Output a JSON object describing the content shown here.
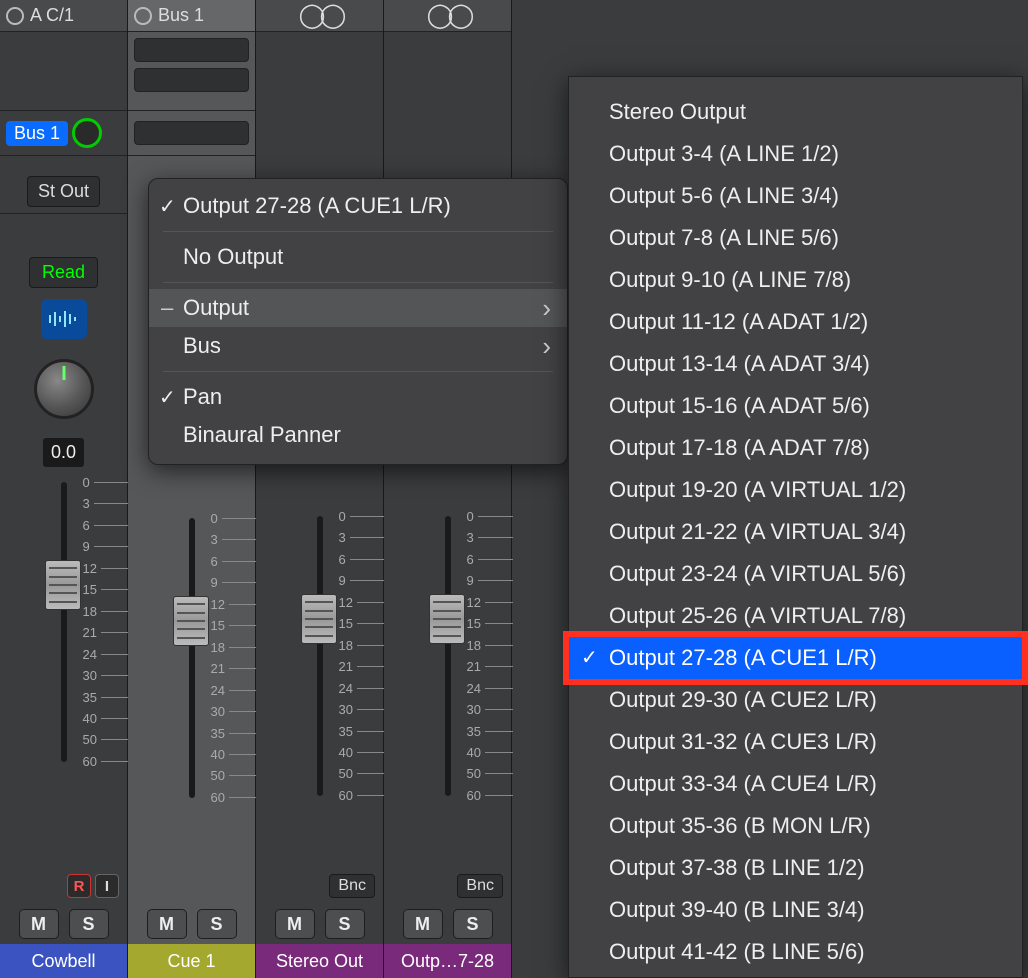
{
  "strips": [
    {
      "io": "A C/1",
      "send": "Bus 1",
      "output": "St Out",
      "automation": "Read",
      "pan_value": "0.0",
      "name": "Cowbell",
      "color": "#3a53c0",
      "has_send_knob": true,
      "has_wave": true,
      "has_ri": true,
      "has_bnc": false
    },
    {
      "io": "Bus 1",
      "name": "Cue 1",
      "color": "#a5a82e",
      "has_bnc": false
    },
    {
      "stereo": true,
      "name": "Stereo Out",
      "color": "#7a2a7a",
      "has_bnc": true,
      "bnc": "Bnc"
    },
    {
      "stereo": true,
      "name": "Outp…7-28",
      "color": "#7a2a7a",
      "has_bnc": true,
      "bnc": "Bnc"
    }
  ],
  "fader_ticks": [
    "0",
    "3",
    "6",
    "9",
    "12",
    "15",
    "18",
    "21",
    "24",
    "30",
    "35",
    "40",
    "50",
    "60"
  ],
  "ms": {
    "mute": "M",
    "solo": "S"
  },
  "ri": {
    "r": "R",
    "i": "I"
  },
  "ctx": {
    "current": "Output 27-28  (A CUE1 L/R)",
    "no_output": "No Output",
    "output": "Output",
    "bus": "Bus",
    "pan": "Pan",
    "binaural": "Binaural Panner"
  },
  "sub": {
    "items": [
      "Stereo Output",
      "Output 3-4  (A LINE 1/2)",
      "Output 5-6  (A LINE 3/4)",
      "Output 7-8  (A LINE 5/6)",
      "Output 9-10  (A LINE 7/8)",
      "Output 11-12  (A ADAT 1/2)",
      "Output 13-14  (A ADAT 3/4)",
      "Output 15-16  (A ADAT 5/6)",
      "Output 17-18  (A ADAT 7/8)",
      "Output 19-20  (A VIRTUAL 1/2)",
      "Output 21-22  (A VIRTUAL 3/4)",
      "Output 23-24  (A VIRTUAL 5/6)",
      "Output 25-26  (A VIRTUAL 7/8)",
      "Output 27-28  (A CUE1 L/R)",
      "Output 29-30  (A CUE2 L/R)",
      "Output 31-32  (A CUE3 L/R)",
      "Output 33-34  (A CUE4 L/R)",
      "Output 35-36  (B MON L/R)",
      "Output 37-38  (B LINE 1/2)",
      "Output 39-40  (B LINE 3/4)",
      "Output 41-42  (B LINE 5/6)"
    ],
    "selected_index": 13
  }
}
